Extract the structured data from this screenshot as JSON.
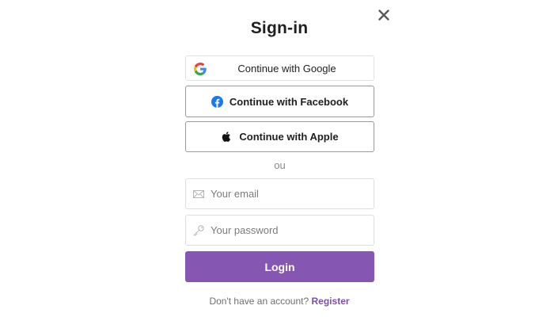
{
  "title": "Sign-in",
  "close": {
    "icon": "close-icon"
  },
  "social": {
    "google": {
      "label": "Continue with Google",
      "icon": "google-icon"
    },
    "facebook": {
      "label": "Continue with Facebook",
      "icon": "facebook-icon",
      "color": "#1877f2"
    },
    "apple": {
      "label": "Continue with Apple",
      "icon": "apple-icon"
    }
  },
  "divider": "ou",
  "form": {
    "email": {
      "placeholder": "Your email",
      "value": "",
      "icon": "envelope-icon"
    },
    "password": {
      "placeholder": "Your password",
      "value": "",
      "icon": "key-icon"
    },
    "login_label": "Login"
  },
  "register": {
    "prompt": "Don't have an account?",
    "link_label": "Register"
  },
  "colors": {
    "accent": "#8557b3",
    "link": "#7b4fa6"
  }
}
